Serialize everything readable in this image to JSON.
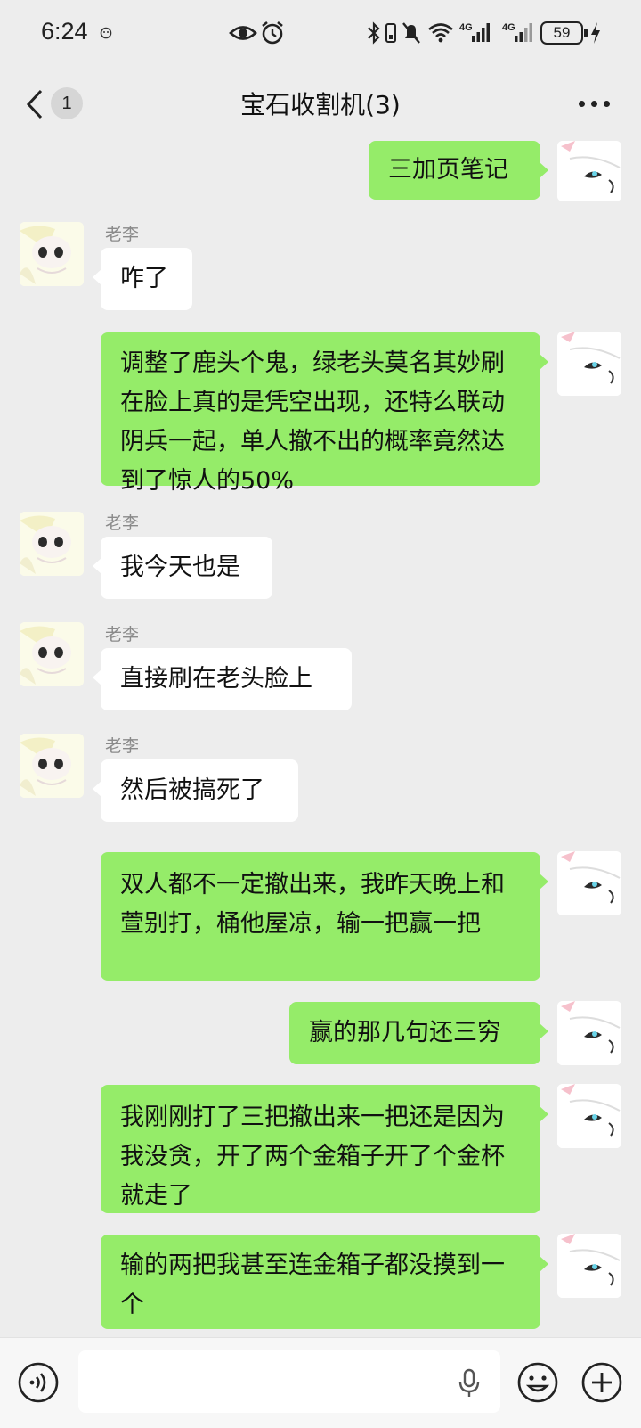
{
  "status_bar": {
    "time": "6:24",
    "network_1": "4G",
    "network_2": "4G",
    "battery": "59"
  },
  "header": {
    "unread_count": "1",
    "title": "宝石收割机(3)"
  },
  "messages": [
    {
      "direction": "out",
      "text": "三加页笔记"
    },
    {
      "direction": "in",
      "sender": "老李",
      "text": "咋了"
    },
    {
      "direction": "out",
      "text": "调整了鹿头个鬼，绿老头莫名其妙刷在脸上真的是凭空出现，还特么联动阴兵一起，单人撤不出的概率竟然达到了惊人的50%"
    },
    {
      "direction": "in",
      "sender": "老李",
      "text": "我今天也是"
    },
    {
      "direction": "in",
      "sender": "老李",
      "text": "直接刷在老头脸上"
    },
    {
      "direction": "in",
      "sender": "老李",
      "text": "然后被搞死了"
    },
    {
      "direction": "out",
      "text": "双人都不一定撤出来，我昨天晚上和萱别打，桶他屋凉，输一把赢一把"
    },
    {
      "direction": "out",
      "text": "赢的那几句还三穷"
    },
    {
      "direction": "out",
      "text": "我刚刚打了三把撤出来一把还是因为我没贪，开了两个金箱子开了个金杯就走了"
    },
    {
      "direction": "out",
      "text": "输的两把我甚至连金箱子都没摸到一个"
    }
  ],
  "input": {
    "value": "",
    "placeholder": ""
  },
  "colors": {
    "outgoing_bubble": "#95ec69",
    "incoming_bubble": "#ffffff",
    "background": "#ededed"
  },
  "icons": {
    "back": "chevron-left-icon",
    "more": "more-dots-icon",
    "voice": "voice-icon",
    "mic": "mic-icon",
    "emoji": "emoji-icon",
    "plus": "plus-icon"
  }
}
